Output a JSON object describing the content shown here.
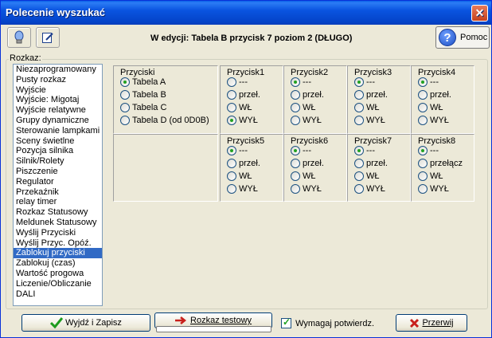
{
  "window": {
    "title": "Polecenie wyszukać"
  },
  "toolbar": {
    "edit_title": "W edycji: Tabela B przycisk 7 poziom 2  (DŁUGO)",
    "help_label": "Pomoc"
  },
  "command_list": {
    "label": "Rozkaz:",
    "items": [
      "Niezaprogramowany",
      "Pusty rozkaz",
      "Wyjście",
      "Wyjście: Migotaj",
      "Wyjście relatywne",
      "Grupy dynamiczne",
      "Sterowanie lampkami",
      "Sceny świetlne",
      "Pozycja silnika",
      "Silnik/Rolety",
      "Piszczenie",
      "Regulator",
      "Przekaźnik",
      "relay timer",
      "Rozkaz Statusowy",
      "Meldunek Statusowy",
      "Wyślij Przyciski",
      "Wyślij Przyc. Opóź.",
      "Zablokuj przyciski",
      "Zablokuj (czas)",
      "Wartość progowa",
      "Liczenie/Obliczanie",
      "DALI"
    ],
    "selected_index": 18
  },
  "przyciski": {
    "title": "Przyciski",
    "options": [
      "Tabela A",
      "Tabela B",
      "Tabela C",
      "Tabela D (od 0D0B)"
    ],
    "selected_index": 0
  },
  "buttons": [
    {
      "title": "Przycisk1",
      "options": [
        "---",
        "przeł.",
        "WŁ",
        "WYŁ"
      ],
      "selected_index": 3
    },
    {
      "title": "Przycisk2",
      "options": [
        "---",
        "przeł.",
        "WŁ",
        "WYŁ"
      ],
      "selected_index": 0
    },
    {
      "title": "Przycisk3",
      "options": [
        "---",
        "przeł.",
        "WŁ",
        "WYŁ"
      ],
      "selected_index": 0
    },
    {
      "title": "Przycisk4",
      "options": [
        "---",
        "przeł.",
        "WŁ",
        "WYŁ"
      ],
      "selected_index": 0
    },
    {
      "title": "Przycisk5",
      "options": [
        "---",
        "przeł.",
        "WŁ",
        "WYŁ"
      ],
      "selected_index": 0
    },
    {
      "title": "Przycisk6",
      "options": [
        "---",
        "przeł.",
        "WŁ",
        "WYŁ"
      ],
      "selected_index": 0
    },
    {
      "title": "Przycisk7",
      "options": [
        "---",
        "przeł.",
        "WŁ",
        "WYŁ"
      ],
      "selected_index": 0
    },
    {
      "title": "Przycisk8",
      "options": [
        "---",
        "przełącz",
        "WŁ",
        "WYŁ"
      ],
      "selected_index": 0
    }
  ],
  "footer": {
    "exit_save_label": "Wyjdź i Zapisz",
    "test_command_label": "Rozkaz testowy",
    "require_confirm_label": "Wymagaj potwierdz.",
    "require_confirm_checked": true,
    "cancel_label": "Przerwij"
  },
  "icons": {
    "close": "close-icon",
    "bulb": "lightbulb-icon",
    "edit": "edit-icon",
    "help": "help-icon",
    "check": "checkmark-icon",
    "arrow": "arrow-right-icon",
    "cancel": "cancel-x-icon"
  }
}
